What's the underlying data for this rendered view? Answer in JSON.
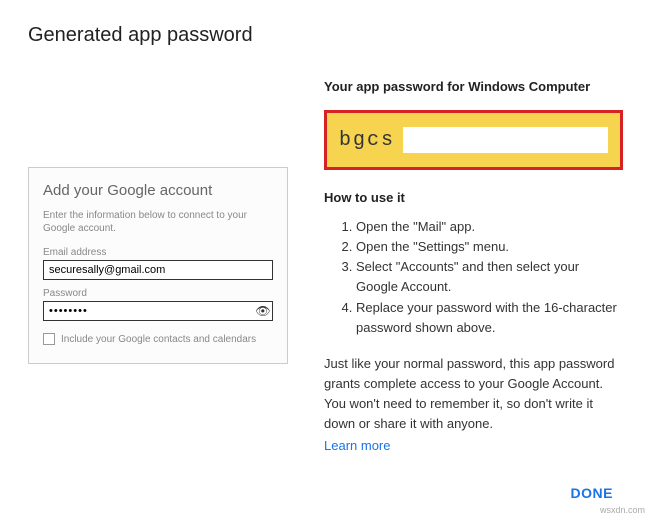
{
  "page_title": "Generated app password",
  "left_card": {
    "title": "Add your Google account",
    "instruction": "Enter the information below to connect to your Google account.",
    "email_label": "Email address",
    "email_value": "securesally@gmail.com",
    "password_label": "Password",
    "password_value": "••••••••",
    "checkbox_label": "Include your Google contacts and calendars"
  },
  "right_panel": {
    "heading": "Your app password for Windows Computer",
    "generated_password_prefix": "bgcs",
    "howto_title": "How to use it",
    "howto_steps": [
      "Open the \"Mail\" app.",
      "Open the \"Settings\" menu.",
      "Select \"Accounts\" and then select your Google Account.",
      "Replace your password with the 16-character password shown above."
    ],
    "disclaimer": "Just like your normal password, this app password grants complete access to your Google Account. You won't need to remember it, so don't write it down or share it with anyone.",
    "learn_more": "Learn more",
    "done_label": "DONE"
  },
  "watermark": "wsxdn.com"
}
